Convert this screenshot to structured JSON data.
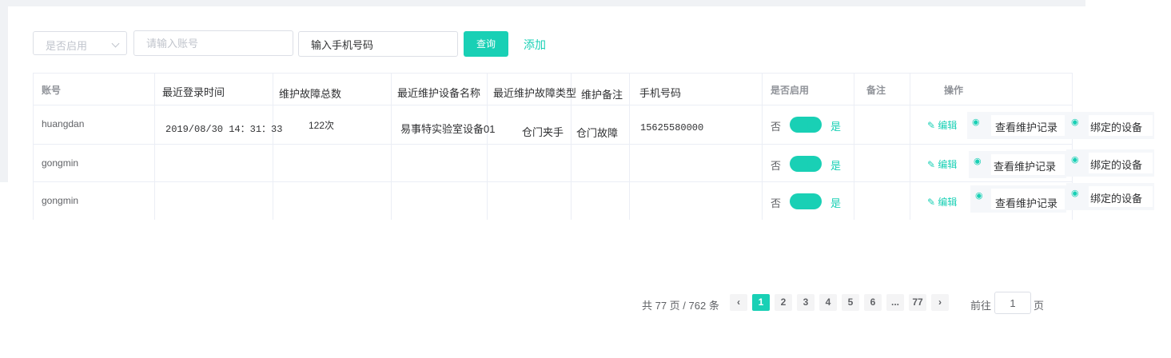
{
  "filters": {
    "enable_select_placeholder": "是否启用",
    "account_placeholder": "请输入账号",
    "phone_value": "输入手机号码",
    "query_label": "查询",
    "add_label": "添加"
  },
  "table": {
    "headers": [
      "账号",
      "最近登录时间",
      "维护故障总数",
      "最近维护设备名称",
      "最近维护故障类型",
      "维护备注",
      "手机号码",
      "是否启用",
      "备注",
      "操作"
    ],
    "rows": [
      {
        "account": "huangdan",
        "last_login": "2019/08/30 14：31：33",
        "fault_total": "122次",
        "device_name": "易事特实验室设备01",
        "fault_type": "仓门夹手",
        "remark_maint": "仓门故障",
        "phone": "15625580000",
        "enabled": true
      },
      {
        "account": "gongmin",
        "last_login": "",
        "fault_total": "",
        "device_name": "",
        "fault_type": "",
        "remark_maint": "",
        "phone": "",
        "enabled": true
      },
      {
        "account": "gongmin",
        "last_login": "",
        "fault_total": "",
        "device_name": "",
        "fault_type": "",
        "remark_maint": "",
        "phone": "",
        "enabled": true
      }
    ],
    "switch_off_label": "否",
    "switch_on_label": "是",
    "actions": {
      "edit": "编辑",
      "view_records": "查看维护记录",
      "bound_devices": "绑定的设备"
    }
  },
  "pagination": {
    "summary": "共 77 页 / 762 条",
    "pages": [
      "1",
      "2",
      "3",
      "4",
      "5",
      "6",
      "...",
      "77"
    ],
    "current": "1",
    "goto_prefix": "前往",
    "goto_value": "1",
    "goto_suffix": "页"
  },
  "colors": {
    "accent": "#19d0b5",
    "border": "#ebeef5",
    "header_text": "#909399"
  }
}
